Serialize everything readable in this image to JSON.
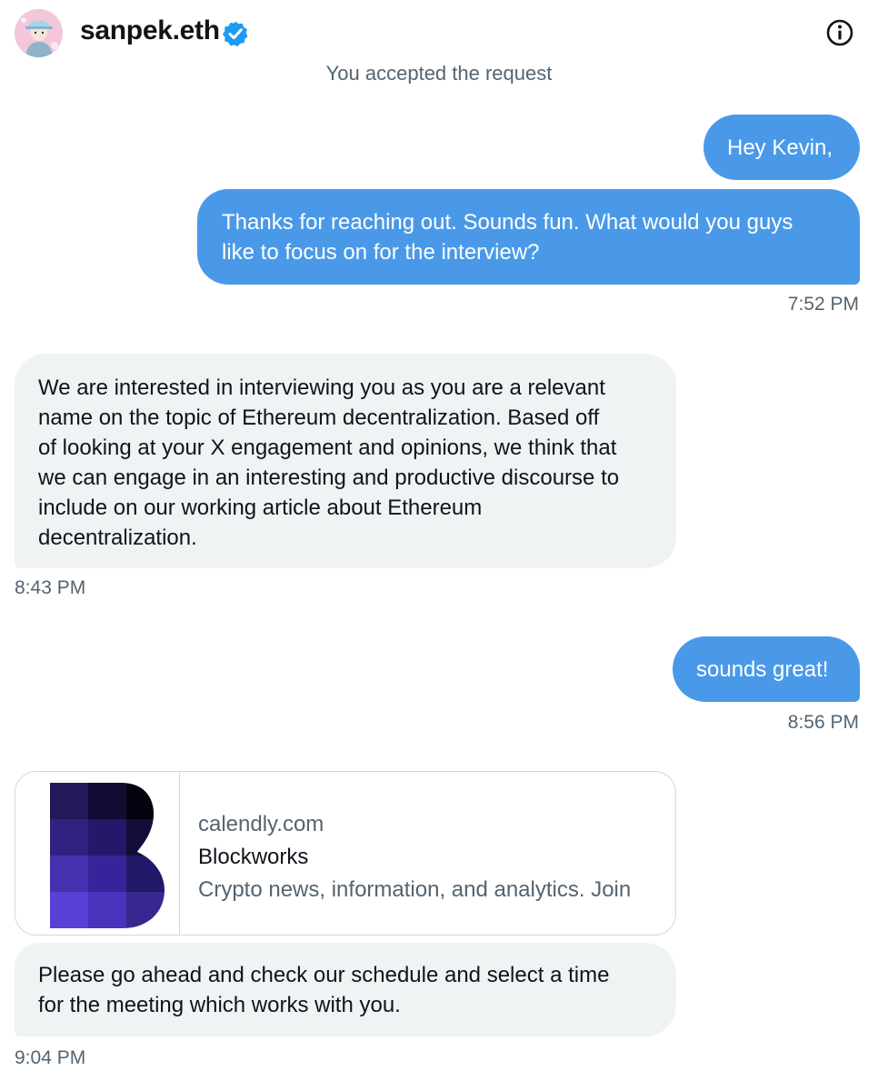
{
  "header": {
    "username": "sanpek.eth",
    "verified_icon": "verified-badge-icon",
    "info_icon": "info-icon",
    "accent_color": "#1d9bf0"
  },
  "system_note": "You accepted the request",
  "messages": [
    {
      "id": "m1",
      "direction": "outgoing",
      "text": "Hey Kevin,"
    },
    {
      "id": "m2",
      "direction": "outgoing",
      "lines": [
        "Thanks for reaching out.  Sounds fun.  What would you guys",
        "like to focus on for the interview?"
      ],
      "time": "7:52 PM"
    },
    {
      "id": "m3",
      "direction": "incoming",
      "lines": [
        "We are interested in interviewing you as you are a relevant",
        "name on the topic of Ethereum decentralization. Based off",
        "of looking at your X engagement and opinions, we think that",
        "we can engage in an interesting and productive discourse to",
        "include on our working article about Ethereum",
        "decentralization."
      ],
      "time": "8:43 PM"
    },
    {
      "id": "m4",
      "direction": "outgoing",
      "text": "sounds great!",
      "time": "8:56 PM"
    },
    {
      "id": "m5",
      "direction": "incoming",
      "lines": [
        "Please go ahead and check our schedule and select a time",
        "for the meeting  which works with you."
      ],
      "time": "9:04 PM"
    }
  ],
  "link_card": {
    "domain": "calendly.com",
    "title": "Blockworks",
    "description": "Crypto news, information, and analytics. Join",
    "logo_icon": "blockworks-logo"
  },
  "colors": {
    "outgoing_bubble": "#4a99e9",
    "incoming_bubble": "#eff3f4",
    "timestamp": "#536471"
  }
}
